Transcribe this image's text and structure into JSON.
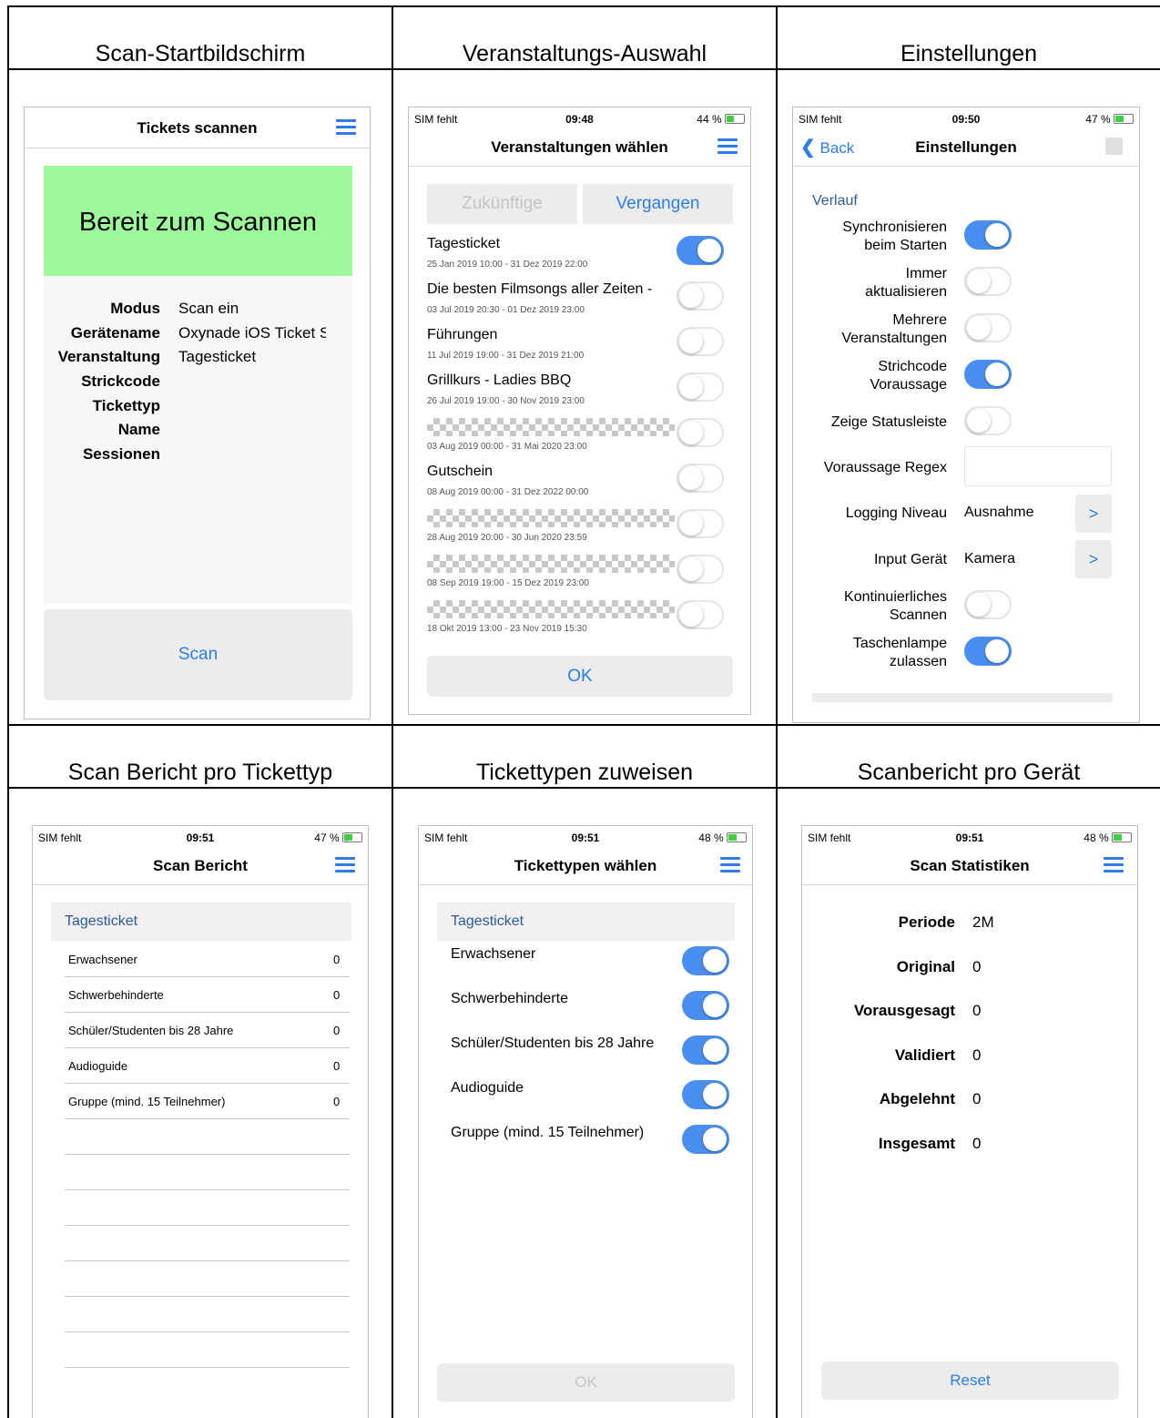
{
  "headers": {
    "h1": "Scan-Startbildschirm",
    "h2": "Veranstaltungs-Auswahl",
    "h3": "Einstellungen",
    "h4": "Scan Bericht pro Tickettyp",
    "h5": "Tickettypen zuweisen",
    "h6": "Scanbericht pro Gerät"
  },
  "colors": {
    "accent": "#2b7de9",
    "ready_green": "#9dfa9a",
    "toggle_on": "#4a8ff0"
  },
  "scan_home": {
    "title": "Tickets scannen",
    "banner": "Bereit zum Scannen",
    "fields": [
      {
        "label": "Modus",
        "value": "Scan ein"
      },
      {
        "label": "Gerätename",
        "value": "Oxynade iOS Ticket S"
      },
      {
        "label": "Veranstaltung",
        "value": "Tagesticket"
      },
      {
        "label": "Strickcode",
        "value": ""
      },
      {
        "label": "Tickettyp",
        "value": ""
      },
      {
        "label": "Name",
        "value": ""
      },
      {
        "label": "Sessionen",
        "value": ""
      }
    ],
    "scan_button": "Scan"
  },
  "events": {
    "status": {
      "sim": "SIM fehlt",
      "time": "09:48",
      "battery": "44 %",
      "battery_level": 0.44
    },
    "title": "Veranstaltungen wählen",
    "tab_future": "Zukünftige",
    "tab_past": "Vergangen",
    "items": [
      {
        "name": "Tagesticket",
        "dates": "25 Jan 2019 10:00 - 31 Dez 2019 22:00",
        "on": true,
        "redacted": false
      },
      {
        "name": "Die besten Filmsongs aller Zeiten -",
        "dates": "03 Jul 2019 20:30 - 01 Dez 2019 23:00",
        "on": false,
        "redacted": false
      },
      {
        "name": "Führungen",
        "dates": "11 Jul 2019 19:00 - 31 Dez 2019 21:00",
        "on": false,
        "redacted": false
      },
      {
        "name": "Grillkurs - Ladies BBQ",
        "dates": "26 Jul 2019 19:00 - 30 Nov 2019 23:00",
        "on": false,
        "redacted": false
      },
      {
        "name": "",
        "dates": "03 Aug 2019 00:00 - 31 Mai 2020 23:00",
        "on": false,
        "redacted": true
      },
      {
        "name": "Gutschein",
        "dates": "08 Aug 2019 00:00 - 31 Dez 2022 00:00",
        "on": false,
        "redacted": false
      },
      {
        "name": "",
        "dates": "28 Aug 2019 20:00 - 30 Jun 2020 23:59",
        "on": false,
        "redacted": true
      },
      {
        "name": "",
        "dates": "08 Sep 2019 19:00 - 15 Dez 2019 23:00",
        "on": false,
        "redacted": true
      },
      {
        "name": "",
        "dates": "18 Okt 2019 13:00 - 23 Nov 2019 15:30",
        "on": false,
        "redacted": true
      }
    ],
    "ok": "OK"
  },
  "settings": {
    "status": {
      "sim": "SIM fehlt",
      "time": "09:50",
      "battery": "47 %",
      "battery_level": 0.47
    },
    "back": "Back",
    "title": "Einstellungen",
    "section": "Verlauf",
    "toggles": [
      {
        "l1": "Synchronisieren",
        "l2": "beim Starten",
        "on": true
      },
      {
        "l1": "Immer",
        "l2": "aktualisieren",
        "on": false
      },
      {
        "l1": "Mehrere",
        "l2": "Veranstaltungen",
        "on": false
      },
      {
        "l1": "Strichcode",
        "l2": "Voraussage",
        "on": true
      },
      {
        "l1": "Zeige Statusleiste",
        "l2": "",
        "on": false
      }
    ],
    "regex_label": "Voraussage Regex",
    "logging_label": "Logging Niveau",
    "logging_value": "Ausnahme",
    "input_label": "Input Gerät",
    "input_value": "Kamera",
    "toggles2": [
      {
        "l1": "Kontinuierliches",
        "l2": "Scannen",
        "on": false
      },
      {
        "l1": "Taschenlampe",
        "l2": "zulassen",
        "on": true
      }
    ],
    "chevron": ">"
  },
  "report": {
    "status": {
      "sim": "SIM fehlt",
      "time": "09:51",
      "battery": "47 %",
      "battery_level": 0.47
    },
    "title": "Scan Bericht",
    "section": "Tagesticket",
    "rows": [
      {
        "name": "Erwachsener",
        "count": "0"
      },
      {
        "name": "Schwerbehinderte",
        "count": "0"
      },
      {
        "name": "Schüler/Studenten bis 28 Jahre",
        "count": "0"
      },
      {
        "name": "Audioguide",
        "count": "0"
      },
      {
        "name": "Gruppe (mind. 15 Teilnehmer)",
        "count": "0"
      }
    ]
  },
  "types": {
    "status": {
      "sim": "SIM fehlt",
      "time": "09:51",
      "battery": "48 %",
      "battery_level": 0.48
    },
    "title": "Tickettypen wählen",
    "section": "Tagesticket",
    "rows": [
      {
        "name": "Erwachsener",
        "on": true
      },
      {
        "name": "Schwerbehinderte",
        "on": true
      },
      {
        "name": "Schüler/Studenten bis 28 Jahre",
        "on": true
      },
      {
        "name": "Audioguide",
        "on": true
      },
      {
        "name": "Gruppe (mind. 15 Teilnehmer)",
        "on": true
      }
    ],
    "ok": "OK"
  },
  "stats": {
    "status": {
      "sim": "SIM fehlt",
      "time": "09:51",
      "battery": "48 %",
      "battery_level": 0.48
    },
    "title": "Scan Statistiken",
    "fields": [
      {
        "label": "Periode",
        "value": "2M"
      },
      {
        "label": "Original",
        "value": "0"
      },
      {
        "label": "Vorausgesagt",
        "value": "0"
      },
      {
        "label": "Validiert",
        "value": "0"
      },
      {
        "label": "Abgelehnt",
        "value": "0"
      },
      {
        "label": "Insgesamt",
        "value": "0"
      }
    ],
    "reset": "Reset"
  }
}
